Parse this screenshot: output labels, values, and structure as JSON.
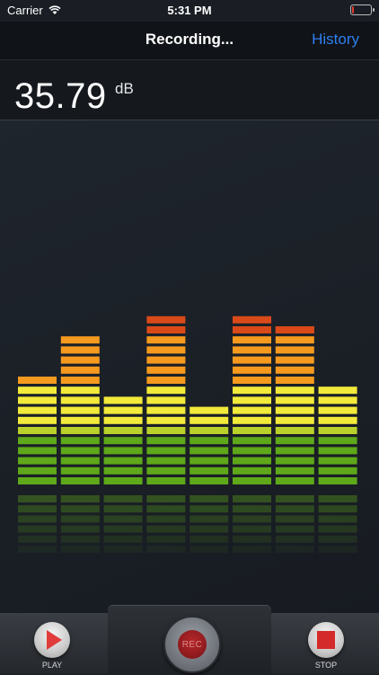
{
  "status_bar": {
    "carrier": "Carrier",
    "time": "5:31 PM",
    "battery_level": 0.05
  },
  "nav": {
    "title": "Recording...",
    "history_label": "History"
  },
  "readout": {
    "value": "35.79",
    "unit": "dB"
  },
  "meter": {
    "segments_max": 17,
    "levels": [
      11,
      15,
      9,
      17,
      8,
      17,
      16,
      10
    ],
    "peak_hold": [
      null,
      null,
      null,
      null,
      null,
      null,
      16,
      null
    ],
    "colors": {
      "green": "#5ea81a",
      "yellow_green": "#b9d12a",
      "yellow": "#f2ea3a",
      "orange": "#f59a1e",
      "red": "#d94a18"
    }
  },
  "controls": {
    "play_label": "PLAY",
    "rec_label": "REC",
    "stop_label": "STOP",
    "play_color": "#e23b3b",
    "stop_color": "#d42a2a"
  }
}
